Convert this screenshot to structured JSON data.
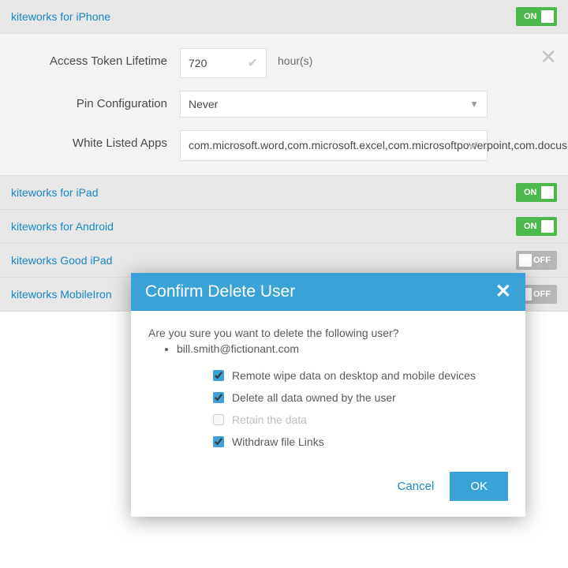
{
  "sections": {
    "iphone": {
      "title": "kiteworks for iPhone",
      "state": "ON"
    },
    "ipad": {
      "title": "kiteworks for iPad",
      "state": "ON"
    },
    "android": {
      "title": "kiteworks for Android",
      "state": "ON"
    },
    "goodipad": {
      "title": "kiteworks Good iPad",
      "state": "OFF"
    },
    "mobileiron": {
      "title": "kiteworks MobileIron",
      "state": "OFF"
    }
  },
  "iphone_form": {
    "token_label": "Access Token Lifetime",
    "token_value": "720",
    "token_unit": "hour(s)",
    "pin_label": "Pin Configuration",
    "pin_value": "Never",
    "wl_label": "White Listed Apps",
    "wl_value": "com.microsoft.word,com.microsoft.excel,com.microsoftpowerpoint,com.docusign.DocuSignIt,com.accellion.*"
  },
  "dialog": {
    "title": "Confirm Delete User",
    "prompt": "Are you sure you want to delete the following user?",
    "user": "bill.smith@fictionant.com",
    "options": {
      "wipe": "Remote wipe data on desktop and mobile devices",
      "delete": "Delete all data owned by the user",
      "retain": "Retain the data",
      "links": "Withdraw file Links"
    },
    "cancel": "Cancel",
    "ok": "OK"
  },
  "toggle_on_label": "ON",
  "toggle_off_label": "OFF"
}
